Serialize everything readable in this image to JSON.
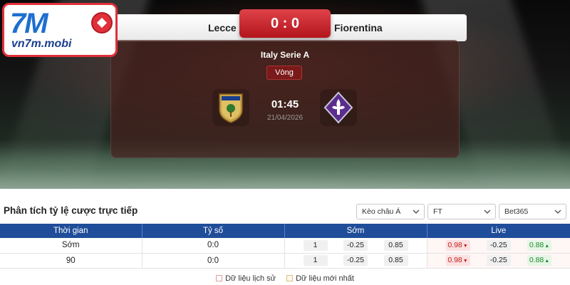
{
  "brand": {
    "logo_mark": "7M",
    "logo_sub": "vn7m.mobi"
  },
  "match": {
    "home_team": "Lecce",
    "away_team": "Fiorentina",
    "score": "0 : 0",
    "league": "Italy Serie A",
    "round_label": "Vòng",
    "time": "01:45",
    "date": "21/04/2026",
    "home_crest": "lecce-crest-icon",
    "away_crest": "fiorentina-crest-icon"
  },
  "odds": {
    "title": "Phân tích tỷ lệ cược trực tiếp",
    "filters": {
      "odds_type": "Kèo châu Á",
      "period": "FT",
      "bookmaker": "Bet365"
    },
    "columns": [
      "Thời gian",
      "Tỷ số",
      "Sớm",
      "Live"
    ],
    "rows": [
      {
        "time": "Sớm",
        "score": "0:0",
        "early": [
          "1",
          "-0.25",
          "0.85"
        ],
        "live": [
          "0.98",
          "-0.25",
          "0.88"
        ]
      },
      {
        "time": "90",
        "score": "0:0",
        "early": [
          "1",
          "-0.25",
          "0.85"
        ],
        "live": [
          "0.98",
          "-0.25",
          "0.88"
        ]
      }
    ],
    "legend": {
      "history": "Dữ liệu lịch sử",
      "latest": "Dữ liệu mới nhất"
    }
  },
  "colors": {
    "header_blue": "#1f4d99",
    "score_red": "#c8232b",
    "odds_down_red": "#c02020",
    "odds_up_green": "#1d8a2e"
  }
}
